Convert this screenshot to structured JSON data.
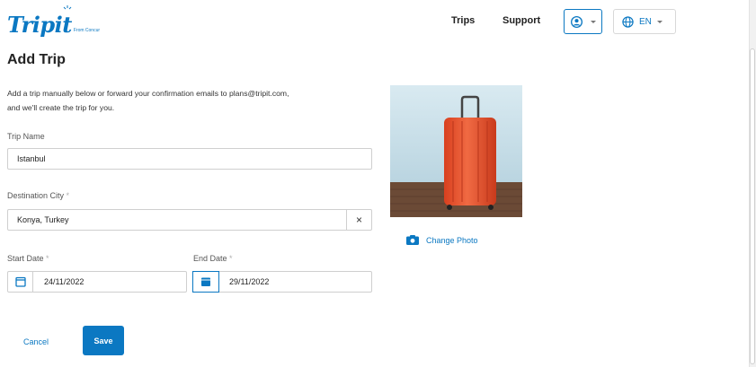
{
  "header": {
    "logo_text": "Trip",
    "logo_text_it": "it",
    "logo_tagline": "From Concur",
    "nav": [
      "Trips",
      "Support"
    ],
    "language": "EN",
    "account_icon": "user-circle-icon",
    "language_icon": "globe-icon"
  },
  "page": {
    "title": "Add Trip",
    "intro_line1": "Add a trip manually below or forward your confirmation emails to plans@tripit.com,",
    "intro_line2": "and we'll create the trip for you."
  },
  "form": {
    "trip_name_label": "Trip Name",
    "trip_name_value": "Istanbul",
    "destination_label": "Destination City",
    "destination_value": "Konya, Turkey",
    "required_mark": "*",
    "start_date_label": "Start Date",
    "start_date_value": "24/11/2022",
    "end_date_label": "End Date",
    "end_date_value": "29/11/2022",
    "clear_symbol": "×",
    "cancel_label": "Cancel",
    "save_label": "Save"
  },
  "photo": {
    "change_label": "Change Photo",
    "camera_icon": "camera-icon"
  },
  "colors": {
    "accent": "#0b78c2",
    "suitcase": "#e8502f",
    "floor": "#6b4a36",
    "sky": "#cfe4ee"
  }
}
